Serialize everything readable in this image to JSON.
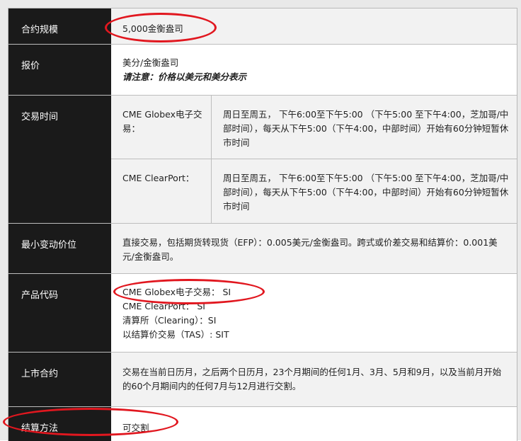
{
  "rows": {
    "contract_size": {
      "label": "合约规模",
      "value": "5,000金衡盎司"
    },
    "price_quote": {
      "label": "报价",
      "value": "美分/金衡盎司",
      "note": "请注意：价格以美元和美分表示"
    },
    "trading_hours": {
      "label": "交易时间",
      "globex": {
        "venue": "CME Globex电子交易：",
        "hours": "周日至周五， 下午6:00至下午5:00 （下午5:00 至下午4:00，芝加哥/中部时间），每天从下午5:00（下午4:00，中部时间）开始有60分钟短暂休市时间"
      },
      "clearport": {
        "venue": "CME ClearPort：",
        "hours": "周日至周五， 下午6:00至下午5:00 （下午5:00 至下午4:00，芝加哥/中部时间），每天从下午5:00（下午4:00，中部时间）开始有60分钟短暂休市时间"
      }
    },
    "min_tick": {
      "label": "最小变动价位",
      "value": "直接交易，包括期货转现货（EFP）：0.005美元/金衡盎司。跨式或价差交易和结算价：0.001美元/金衡盎司。"
    },
    "product_code": {
      "label": "产品代码",
      "lines": [
        "CME Globex电子交易： SI",
        "CME ClearPort： SI",
        "清算所（Clearing）：SI",
        "以结算价交易（TAS）: SIT"
      ]
    },
    "listed_contracts": {
      "label": "上市合约",
      "value": "交易在当前日历月，之后两个日历月，23个月期间的任何1月、3月、5月和9月，以及当前月开始的60个月期间内的任何7月与12月进行交割。"
    },
    "settlement": {
      "label": "结算方法",
      "value": "可交割"
    }
  },
  "annotations": {
    "ring_color": "#e1171f"
  }
}
